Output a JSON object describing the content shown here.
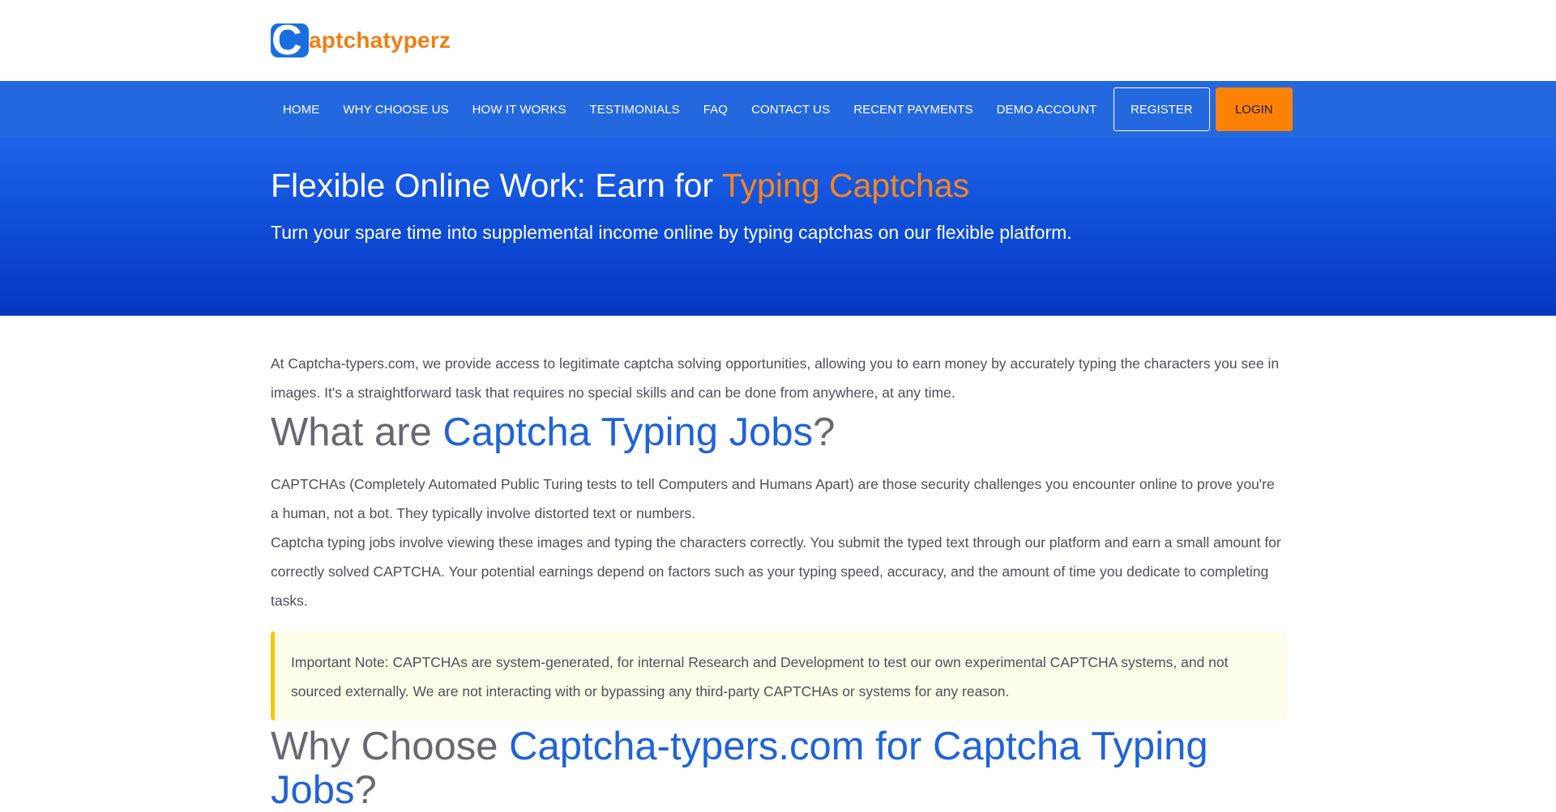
{
  "logo": {
    "mark_letter": "C",
    "text": "aptchatyperz"
  },
  "nav": {
    "items": [
      {
        "label": "HOME"
      },
      {
        "label": "WHY CHOOSE US"
      },
      {
        "label": "HOW IT WORKS"
      },
      {
        "label": "TESTIMONIALS"
      },
      {
        "label": "FAQ"
      },
      {
        "label": "CONTACT US"
      },
      {
        "label": "RECENT PAYMENTS"
      },
      {
        "label": "DEMO ACCOUNT"
      }
    ],
    "register_label": "REGISTER",
    "login_label": "LOGIN"
  },
  "hero": {
    "title_prefix": "Flexible Online Work: Earn for ",
    "title_accent": "Typing Captchas",
    "subtitle": "Turn your spare time into supplemental income online by typing captchas on our flexible platform."
  },
  "main": {
    "intro": "At Captcha-typers.com, we provide access to legitimate captcha solving opportunities, allowing you to earn money by accurately typing the characters you see in images. It's a straightforward task that requires no special skills and can be done from anywhere, at any time.",
    "what_heading_prefix": "What are ",
    "what_heading_accent": "Captcha Typing Jobs",
    "what_heading_suffix": "?",
    "what_p1": "CAPTCHAs (Completely Automated Public Turing tests to tell Computers and Humans Apart) are those security challenges you encounter online to prove you're a human, not a bot. They typically involve distorted text or numbers.",
    "what_p2": "Captcha typing jobs involve viewing these images and typing the characters correctly. You submit the typed text through our platform and earn a small amount for correctly solved CAPTCHA. Your potential earnings depend on factors such as your typing speed, accuracy, and the amount of time you dedicate to completing tasks.",
    "note": "Important Note: CAPTCHAs are system-generated, for internal Research and Development to test our own experimental CAPTCHA systems, and not sourced externally. We are not interacting with or bypassing any third-party CAPTCHAs or systems for any reason.",
    "why_heading_prefix": "Why Choose ",
    "why_heading_accent": "Captcha-typers.com for Captcha Typing Jobs",
    "why_heading_suffix": "?"
  },
  "colors": {
    "nav_blue": "#2468e0",
    "hero_blue": "#0f4fd8",
    "accent_orange": "#f9861e",
    "login_orange": "#fc8105",
    "heading_blue": "#1f63d8",
    "note_border": "#f5c60c",
    "note_bg": "#fdfde9"
  }
}
